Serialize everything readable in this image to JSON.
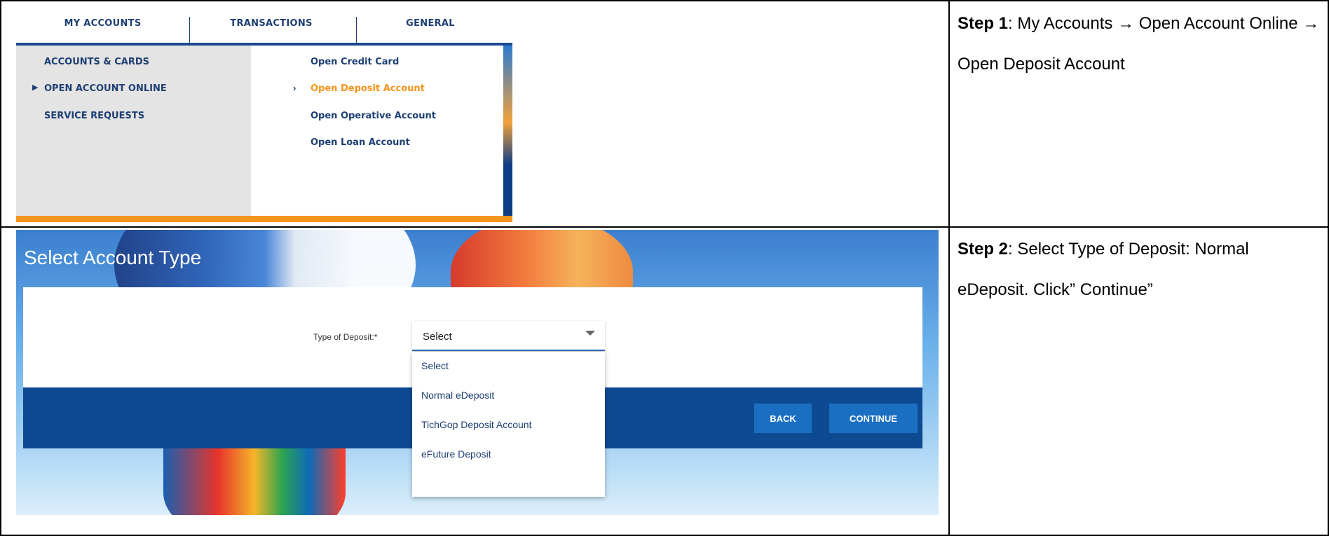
{
  "step1": {
    "menu": {
      "tabs": [
        "MY ACCOUNTS",
        "TRANSACTIONS",
        "GENERAL"
      ],
      "left_items": [
        "ACCOUNTS & CARDS",
        "OPEN ACCOUNT ONLINE",
        "SERVICE REQUESTS"
      ],
      "right_items": [
        "Open Credit Card",
        "Open Deposit Account",
        "Open Operative Account",
        "Open Loan Account"
      ]
    },
    "label": "Step 1",
    "text": ": My Accounts → Open Account Online → Open Deposit Account"
  },
  "step2": {
    "title": "Select Account Type",
    "field_label": "Type of Deposit:*",
    "selected_value": "Select",
    "options": [
      "Select",
      "Normal eDeposit",
      "TichGop Deposit Account",
      "eFuture Deposit"
    ],
    "buttons": {
      "back": "BACK",
      "continue": "CONTINUE"
    },
    "label": "Step 2",
    "text": ": Select Type of Deposit: Normal eDeposit. Click” Continue”"
  }
}
